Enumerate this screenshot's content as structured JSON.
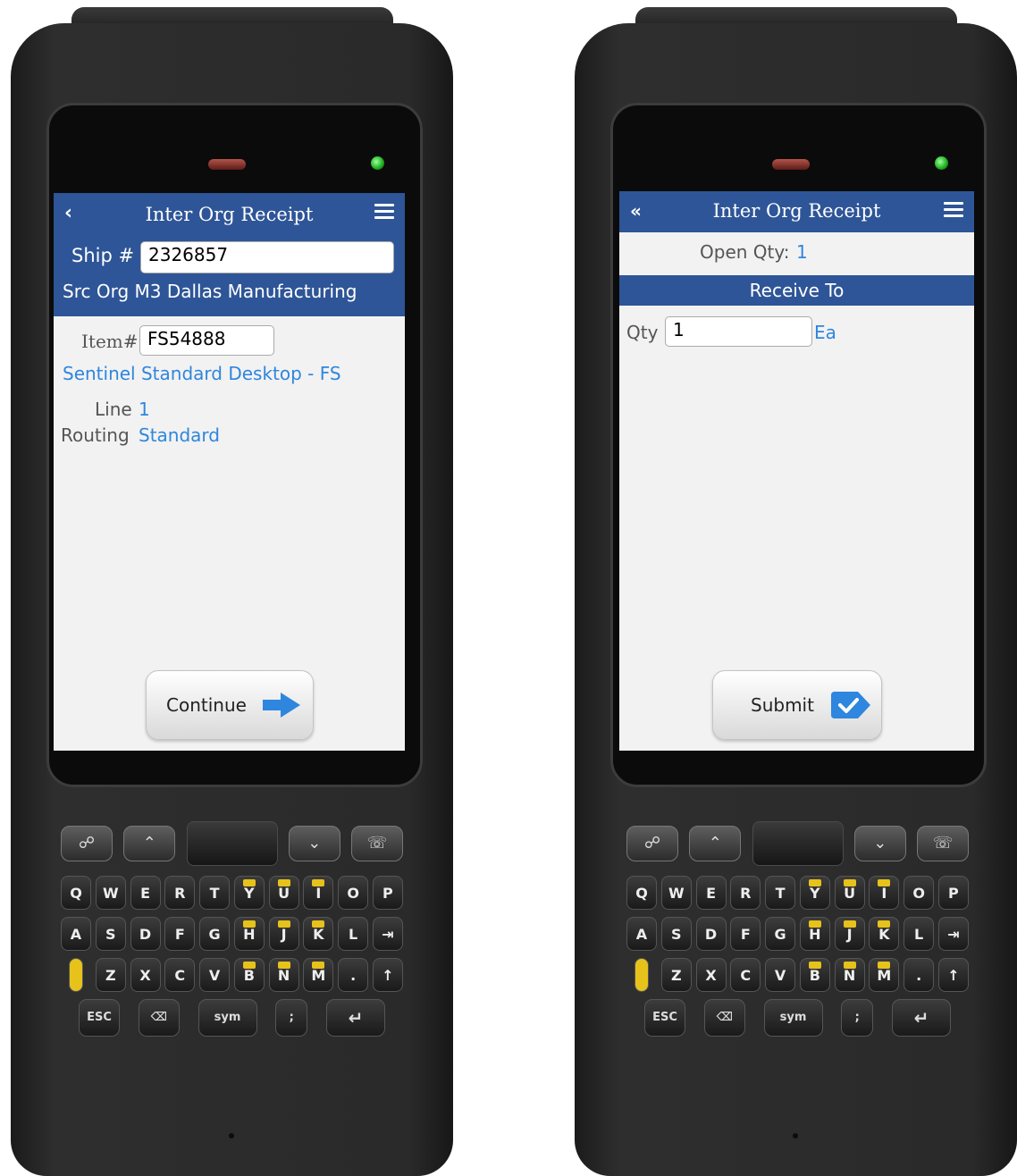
{
  "left_screen": {
    "title": "Inter Org Receipt",
    "ship_label": "Ship #",
    "ship_value": "2326857",
    "src_org": "Src Org M3 Dallas Manufacturing",
    "item_label": "Item#",
    "item_value": "FS54888",
    "item_desc": "Sentinel Standard Desktop - FS",
    "line_label": "Line",
    "line_value": "1",
    "routing_label": "Routing",
    "routing_value": "Standard",
    "continue_label": "Continue"
  },
  "right_screen": {
    "title": "Inter Org Receipt",
    "open_qty_label": "Open Qty:",
    "open_qty_value": "1",
    "receive_to": "Receive To",
    "qty_label": "Qty",
    "qty_value": "1",
    "uom": "Ea",
    "submit_label": "Submit"
  },
  "keyboard": {
    "row1": [
      "Q",
      "W",
      "E",
      "R",
      "T",
      "Y",
      "U",
      "I",
      "O",
      "P"
    ],
    "row2": [
      "A",
      "S",
      "D",
      "F",
      "G",
      "H",
      "J",
      "K",
      "L",
      "⇥"
    ],
    "row3": [
      "",
      "Z",
      "X",
      "C",
      "V",
      "B",
      "N",
      "M",
      ".",
      "↑"
    ],
    "esc": "ESC",
    "backspace": "⌫",
    "sym": "sym",
    "comma": ";",
    "enter": "↵"
  },
  "colors": {
    "header_blue": "#2e5597",
    "link_blue": "#2e86de",
    "led_green": "#22b422"
  }
}
